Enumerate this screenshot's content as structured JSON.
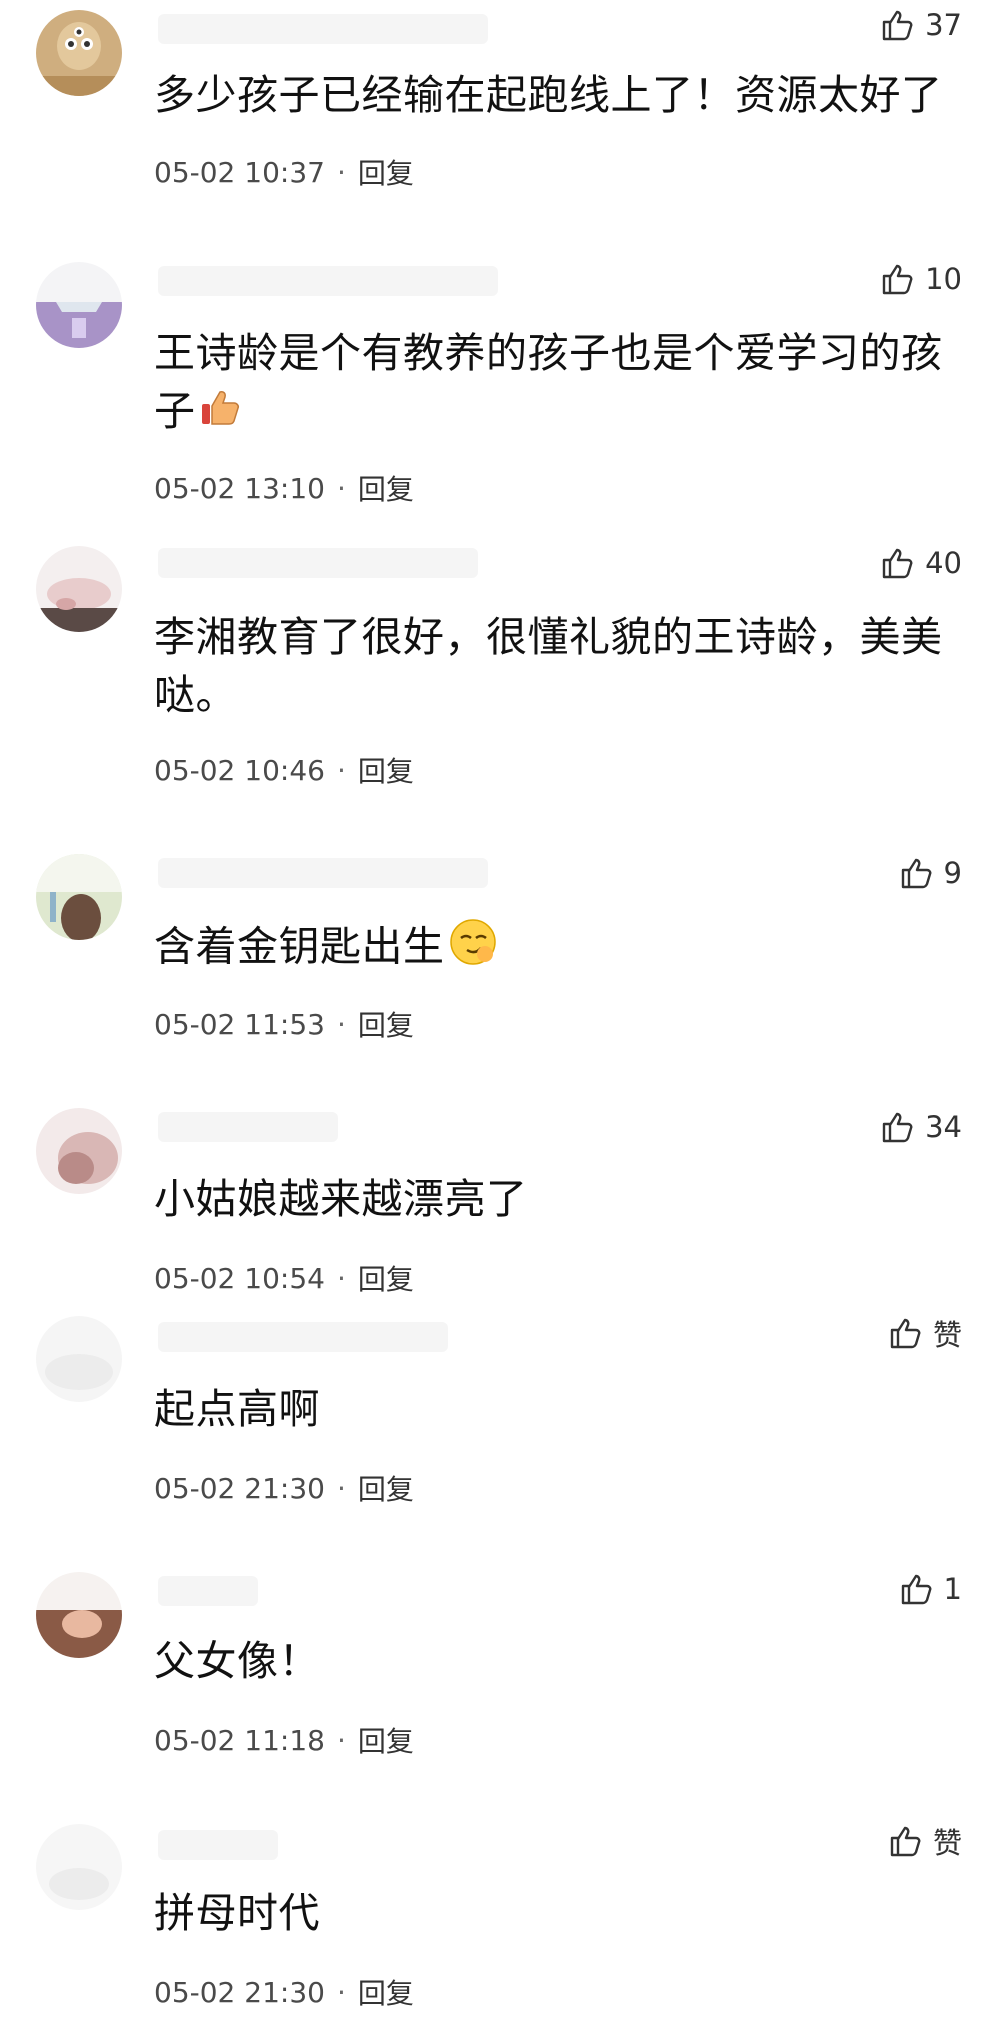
{
  "comments": [
    {
      "text": "多少孩子已经输在起跑线上了！资源太好了",
      "time": "05-02 10:37",
      "reply": "回复",
      "likes": "37"
    },
    {
      "text": "王诗龄是个有教养的孩子也是个爱学习的孩子",
      "emoji": "thumbs-up-emoji",
      "time": "05-02 13:10",
      "reply": "回复",
      "likes": "10"
    },
    {
      "text": "李湘教育了很好，很懂礼貌的王诗龄，美美哒。",
      "time": "05-02 10:46",
      "reply": "回复",
      "likes": "40"
    },
    {
      "text": "含着金钥匙出生",
      "emoji": "sly-smirk-emoji",
      "time": "05-02 11:53",
      "reply": "回复",
      "likes": "9"
    },
    {
      "text": "小姑娘越来越漂亮了",
      "time": "05-02 10:54",
      "reply": "回复",
      "likes": "34"
    },
    {
      "text": "起点高啊",
      "time": "05-02 21:30",
      "reply": "回复",
      "likes": "赞"
    },
    {
      "text": "父女像！",
      "time": "05-02 11:18",
      "reply": "回复",
      "likes": "1"
    },
    {
      "text": "拼母时代",
      "time": "05-02 21:30",
      "reply": "回复",
      "likes": "赞"
    }
  ],
  "meta_separator": "·",
  "icons": {
    "like": "thumbs-up-outline-icon"
  },
  "colors": {
    "text": "#111111",
    "meta": "#4a4a4a",
    "avatar_tones": [
      "#c8a878",
      "#b9a7d0",
      "#e8e2e2",
      "#c9d6b0",
      "#d7b8b8",
      "#f1f1f1",
      "#e6c8b8",
      "#f3f3f3"
    ]
  }
}
